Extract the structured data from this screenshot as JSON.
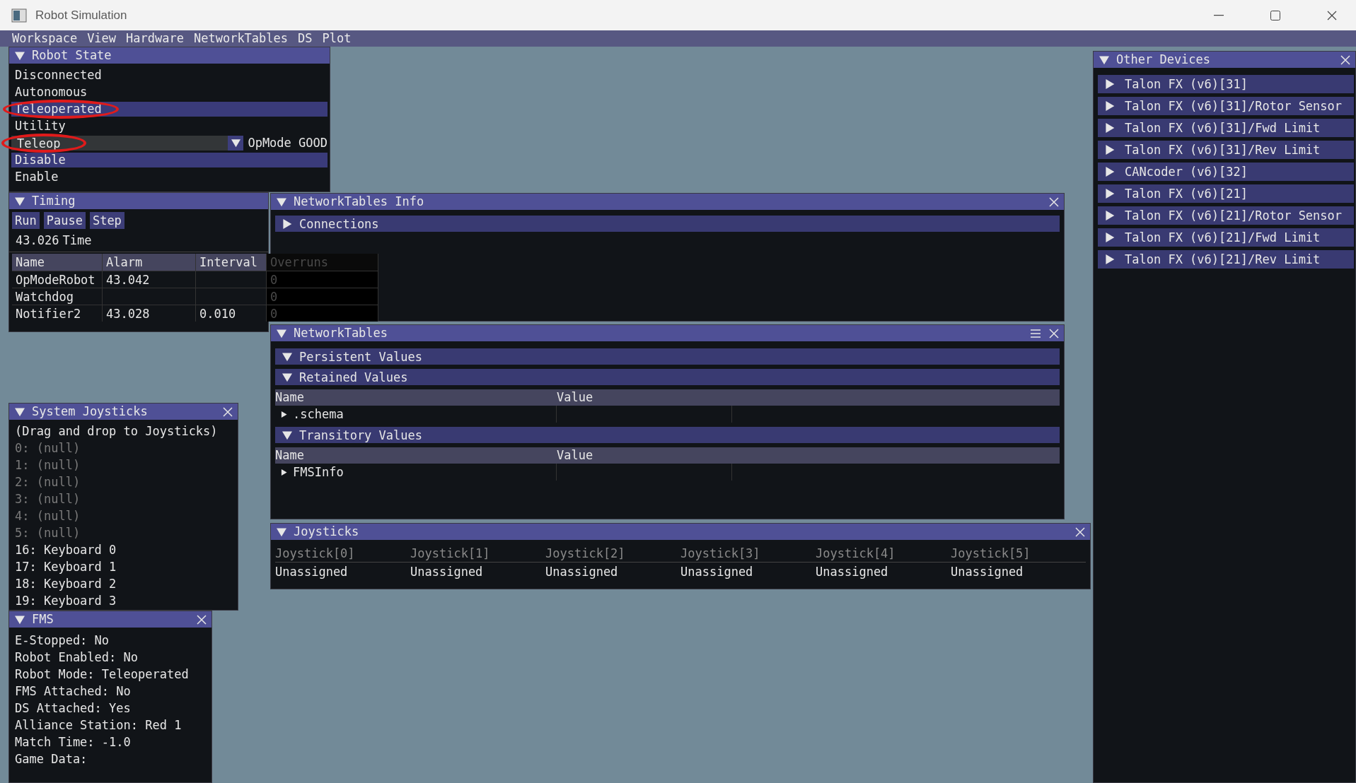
{
  "window": {
    "title": "Robot Simulation"
  },
  "menu": [
    "Workspace",
    "View",
    "Hardware",
    "NetworkTables",
    "DS",
    "Plot"
  ],
  "robot_state": {
    "title": "Robot State",
    "expanded": true,
    "modes": [
      {
        "label": "Disconnected",
        "selected": false,
        "circled": false
      },
      {
        "label": "Autonomous",
        "selected": false,
        "circled": false
      },
      {
        "label": "Teleoperated",
        "selected": true,
        "circled": true
      },
      {
        "label": "Utility",
        "selected": false,
        "circled": false
      }
    ],
    "opmode": {
      "value": "Teleop",
      "status": "OpMode GOOD",
      "circled": true
    },
    "actions": [
      {
        "label": "Disable",
        "selected": true
      },
      {
        "label": "Enable",
        "selected": false
      }
    ]
  },
  "timing": {
    "title": "Timing",
    "expanded": true,
    "buttons": [
      "Run",
      "Pause",
      "Step"
    ],
    "time_value": "43.026",
    "time_label": "Time",
    "columns": [
      "Name",
      "Alarm",
      "Interval",
      "Overruns"
    ],
    "rows": [
      {
        "name": "OpModeRobot",
        "alarm": "43.042",
        "overruns": "0"
      },
      {
        "name": "Watchdog",
        "overruns": "0"
      },
      {
        "name": "Notifier2",
        "alarm": "43.028",
        "interval": "0.010",
        "overruns": "0"
      }
    ]
  },
  "networktables_info": {
    "title": "NetworkTables Info",
    "expanded": true,
    "sections": [
      {
        "label": "Connections",
        "expanded": false
      }
    ]
  },
  "networktables": {
    "title": "NetworkTables",
    "expanded": true,
    "sections": [
      {
        "label": "Persistent Values",
        "expanded": true
      },
      {
        "label": "Retained Values",
        "expanded": true,
        "columns": [
          "Name",
          "Value"
        ],
        "rows": [
          {
            "name": ".schema",
            "expanded": false
          }
        ]
      },
      {
        "label": "Transitory Values",
        "expanded": true,
        "columns": [
          "Name",
          "Value"
        ],
        "rows": [
          {
            "name": "FMSInfo",
            "expanded": false
          }
        ]
      }
    ]
  },
  "system_joysticks": {
    "title": "System Joysticks",
    "expanded": true,
    "hint": "(Drag and drop to Joysticks)",
    "items": [
      {
        "label": "0: (null)",
        "available": false
      },
      {
        "label": "1: (null)",
        "available": false
      },
      {
        "label": "2: (null)",
        "available": false
      },
      {
        "label": "3: (null)",
        "available": false
      },
      {
        "label": "4: (null)",
        "available": false
      },
      {
        "label": "5: (null)",
        "available": false
      },
      {
        "label": "16: Keyboard 0",
        "available": true
      },
      {
        "label": "17: Keyboard 1",
        "available": true
      },
      {
        "label": "18: Keyboard 2",
        "available": true
      },
      {
        "label": "19: Keyboard 3",
        "available": true
      }
    ]
  },
  "fms": {
    "title": "FMS",
    "expanded": true,
    "lines": [
      "E-Stopped:  No",
      "Robot Enabled:  No",
      "Robot Mode:  Teleoperated",
      "FMS Attached:  No",
      "DS Attached:  Yes",
      "Alliance Station:  Red 1",
      "Match Time:  -1.0",
      "Game Data:"
    ]
  },
  "joysticks": {
    "title": "Joysticks",
    "expanded": true,
    "columns": [
      "Joystick[0]",
      "Joystick[1]",
      "Joystick[2]",
      "Joystick[3]",
      "Joystick[4]",
      "Joystick[5]"
    ],
    "values": [
      "Unassigned",
      "Unassigned",
      "Unassigned",
      "Unassigned",
      "Unassigned",
      "Unassigned"
    ]
  },
  "other_devices": {
    "title": "Other Devices",
    "expanded": true,
    "items": [
      {
        "label": "Talon FX (v6)[31]",
        "expanded": false
      },
      {
        "label": "Talon FX (v6)[31]/Rotor Sensor",
        "expanded": false
      },
      {
        "label": "Talon FX (v6)[31]/Fwd Limit",
        "expanded": false
      },
      {
        "label": "Talon FX (v6)[31]/Rev Limit",
        "expanded": false
      },
      {
        "label": "CANcoder (v6)[32]",
        "expanded": false
      },
      {
        "label": "Talon FX (v6)[21]",
        "expanded": false
      },
      {
        "label": "Talon FX (v6)[21]/Rotor Sensor",
        "expanded": false
      },
      {
        "label": "Talon FX (v6)[21]/Fwd Limit",
        "expanded": false
      },
      {
        "label": "Talon FX (v6)[21]/Rev Limit",
        "expanded": false
      }
    ]
  }
}
